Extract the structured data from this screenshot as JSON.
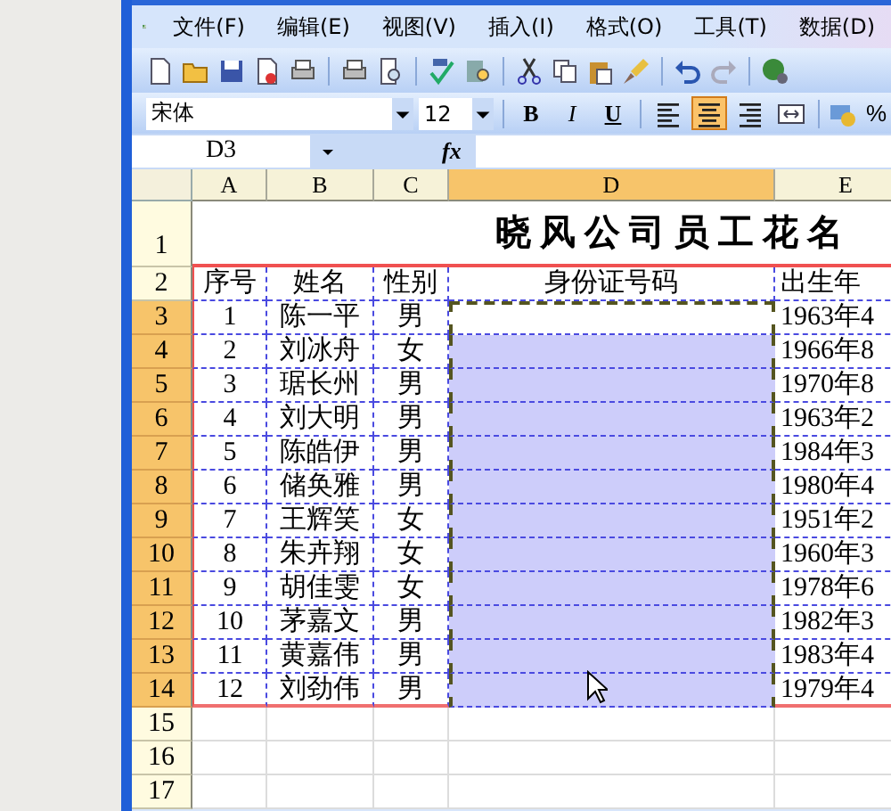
{
  "menu": [
    {
      "label": "文件(F)"
    },
    {
      "label": "编辑(E)"
    },
    {
      "label": "视图(V)"
    },
    {
      "label": "插入(I)"
    },
    {
      "label": "格式(O)"
    },
    {
      "label": "工具(T)"
    },
    {
      "label": "数据(D)"
    }
  ],
  "format_toolbar": {
    "font": "宋体",
    "size": "12",
    "buttons": [
      {
        "kind": "bold",
        "label": "B",
        "selected": false
      },
      {
        "kind": "italic",
        "label": "I",
        "selected": false
      },
      {
        "kind": "underline",
        "label": "U",
        "selected": false
      },
      {
        "kind": "align-left",
        "selected": false
      },
      {
        "kind": "align-center",
        "selected": true
      },
      {
        "kind": "align-right",
        "selected": false
      },
      {
        "kind": "merge",
        "selected": false
      }
    ],
    "percent": "%"
  },
  "formula_bar": {
    "name_box": "D3",
    "fx": "fx"
  },
  "columns": [
    {
      "label": "A",
      "selected": false
    },
    {
      "label": "B",
      "selected": false
    },
    {
      "label": "C",
      "selected": false
    },
    {
      "label": "D",
      "selected": true
    },
    {
      "label": "E",
      "selected": false
    }
  ],
  "title_row": {
    "number": "1",
    "title": "晓风公司员工花名"
  },
  "header_row": {
    "number": "2",
    "cells": {
      "A": "序号",
      "B": "姓名",
      "C": "性别",
      "D": "身份证号码",
      "E": "出生年"
    }
  },
  "rows": [
    {
      "number": "3",
      "selected": true,
      "active": true,
      "cells": {
        "A": "1",
        "B": "陈一平",
        "C": "男",
        "E": "1963年4"
      }
    },
    {
      "number": "4",
      "selected": true,
      "active": false,
      "cells": {
        "A": "2",
        "B": "刘冰舟",
        "C": "女",
        "E": "1966年8"
      }
    },
    {
      "number": "5",
      "selected": true,
      "active": false,
      "cells": {
        "A": "3",
        "B": "琚长州",
        "C": "男",
        "E": "1970年8"
      }
    },
    {
      "number": "6",
      "selected": true,
      "active": false,
      "cells": {
        "A": "4",
        "B": "刘大明",
        "C": "男",
        "E": "1963年2"
      }
    },
    {
      "number": "7",
      "selected": true,
      "active": false,
      "cells": {
        "A": "5",
        "B": "陈皓伊",
        "C": "男",
        "E": "1984年3"
      }
    },
    {
      "number": "8",
      "selected": true,
      "active": false,
      "cells": {
        "A": "6",
        "B": "储奂雅",
        "C": "男",
        "E": "1980年4"
      }
    },
    {
      "number": "9",
      "selected": true,
      "active": false,
      "cells": {
        "A": "7",
        "B": "王辉笑",
        "C": "女",
        "E": "1951年2"
      }
    },
    {
      "number": "10",
      "selected": true,
      "active": false,
      "cells": {
        "A": "8",
        "B": "朱卉翔",
        "C": "女",
        "E": "1960年3"
      }
    },
    {
      "number": "11",
      "selected": true,
      "active": false,
      "cells": {
        "A": "9",
        "B": "胡佳雯",
        "C": "女",
        "E": "1978年6"
      }
    },
    {
      "number": "12",
      "selected": true,
      "active": false,
      "cells": {
        "A": "10",
        "B": "茅嘉文",
        "C": "男",
        "E": "1982年3"
      }
    },
    {
      "number": "13",
      "selected": true,
      "active": false,
      "cells": {
        "A": "11",
        "B": "黄嘉伟",
        "C": "男",
        "E": "1983年4"
      }
    },
    {
      "number": "14",
      "selected": true,
      "active": false,
      "cells": {
        "A": "12",
        "B": "刘劲伟",
        "C": "男",
        "E": "1979年4"
      }
    }
  ],
  "empty_rows": [
    {
      "number": "15",
      "selected": false
    },
    {
      "number": "16",
      "selected": false
    },
    {
      "number": "17",
      "selected": false
    }
  ]
}
